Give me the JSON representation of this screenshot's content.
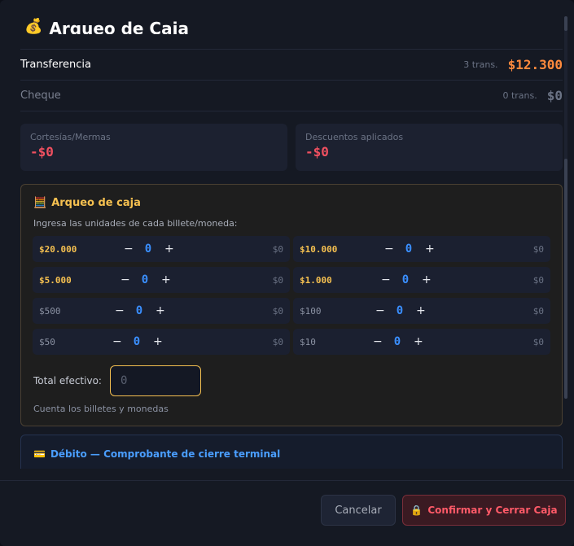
{
  "modal": {
    "title": "Arqueo de Caja",
    "title_icon": "money-bag-icon"
  },
  "payments": [
    {
      "label": "Transferencia",
      "count": "3 trans.",
      "amount": "$12.300",
      "label_color": "#ffffff",
      "amount_color": "#ff8a3d"
    },
    {
      "label": "Cheque",
      "count": "0 trans.",
      "amount": "$0",
      "label_color": "#7a8090",
      "amount_color": "#6b7385"
    }
  ],
  "stats": {
    "cortesias": {
      "label": "Cortesías/Mermas",
      "value": "-$0"
    },
    "descuentos": {
      "label": "Descuentos aplicados",
      "value": "-$0"
    }
  },
  "arqueo": {
    "title": "Arqueo de caja",
    "subtitle": "Ingresa las unidades de cada billete/moneda:",
    "denominations": [
      {
        "label": "$20.000",
        "qty": "0",
        "subtotal": "$0",
        "kind": "bill"
      },
      {
        "label": "$10.000",
        "qty": "0",
        "subtotal": "$0",
        "kind": "bill"
      },
      {
        "label": "$5.000",
        "qty": "0",
        "subtotal": "$0",
        "kind": "bill"
      },
      {
        "label": "$1.000",
        "qty": "0",
        "subtotal": "$0",
        "kind": "bill"
      },
      {
        "label": "$500",
        "qty": "0",
        "subtotal": "$0",
        "kind": "coin"
      },
      {
        "label": "$100",
        "qty": "0",
        "subtotal": "$0",
        "kind": "coin"
      },
      {
        "label": "$50",
        "qty": "0",
        "subtotal": "$0",
        "kind": "coin"
      },
      {
        "label": "$10",
        "qty": "0",
        "subtotal": "$0",
        "kind": "coin"
      }
    ],
    "minus": "−",
    "plus": "+",
    "total_label": "Total efectivo:",
    "total_placeholder": "0",
    "hint": "Cuenta los billetes y monedas"
  },
  "debit": {
    "title": "Débito — Comprobante de cierre terminal"
  },
  "footer": {
    "cancel_label": "Cancelar",
    "confirm_label": "Confirmar y Cerrar Caja"
  },
  "colors": {
    "accent_gold": "#f5c050",
    "accent_blue": "#3a8fff",
    "danger": "#f05060",
    "transfer_amount": "#ff8a3d"
  }
}
